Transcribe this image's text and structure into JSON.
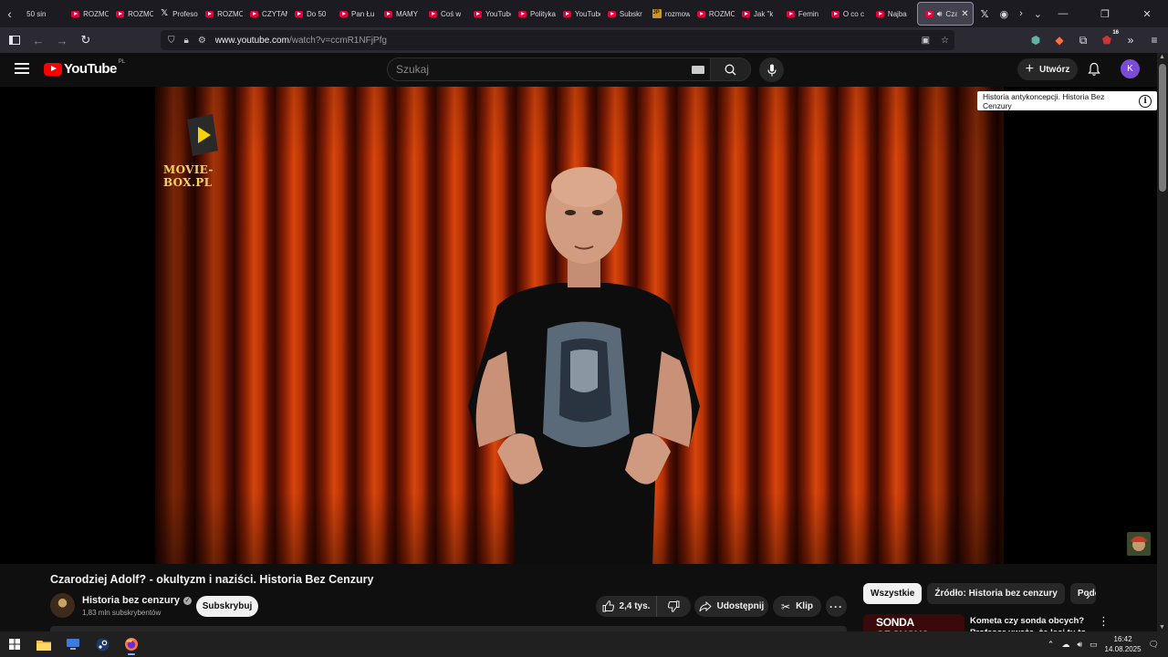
{
  "browser": {
    "tabs": [
      {
        "title": "50 sin",
        "icon": "none"
      },
      {
        "title": "ROZMOWA",
        "icon": "youtube"
      },
      {
        "title": "ROZMOWA",
        "icon": "youtube"
      },
      {
        "title": "Profesor",
        "icon": "x"
      },
      {
        "title": "ROZMOWA",
        "icon": "youtube"
      },
      {
        "title": "CZYTAMY",
        "icon": "youtube"
      },
      {
        "title": "Do 50",
        "icon": "youtube"
      },
      {
        "title": "Pan Łu",
        "icon": "youtube"
      },
      {
        "title": "MAMY",
        "icon": "youtube"
      },
      {
        "title": "Coś w",
        "icon": "youtube"
      },
      {
        "title": "YouTube",
        "icon": "youtube"
      },
      {
        "title": "Polityka",
        "icon": "youtube"
      },
      {
        "title": "YouTube",
        "icon": "youtube"
      },
      {
        "title": "Subskr",
        "icon": "youtube"
      },
      {
        "title": "rozmowa",
        "icon": "jp"
      },
      {
        "title": "ROZMOWA",
        "icon": "youtube"
      },
      {
        "title": "Jak \"k",
        "icon": "youtube"
      },
      {
        "title": "Femin",
        "icon": "youtube"
      },
      {
        "title": "O co c",
        "icon": "youtube"
      },
      {
        "title": "Najba",
        "icon": "youtube"
      }
    ],
    "active_tab": {
      "title": "Czarodziej"
    },
    "url_host": "www.youtube.com",
    "url_path": "/watch?v=ccmR1NFjPfg",
    "extension_badge": "16"
  },
  "youtube": {
    "logo_text": "YouTube",
    "country_code": "PL",
    "search_placeholder": "Szukaj",
    "create_label": "Utwórz",
    "avatar_letter": "K"
  },
  "player": {
    "overlay_logo_text": "MOVIE-BOX.PL",
    "info_card_text": "Historia antykoncepcji. Historia Bez Cenzury"
  },
  "video": {
    "title": "Czarodziej Adolf? - okultyzm i naziści. Historia Bez Cenzury",
    "channel_name": "Historia bez cenzury",
    "subscribers": "1,83 mln subskrybentów",
    "subscribe_label": "Subskrybuj",
    "likes": "2,4 tys.",
    "share_label": "Udostępnij",
    "clip_label": "Klip"
  },
  "sidebar": {
    "chips": [
      "Wszystkie",
      "Źródło: Historia bez cenzury",
      "Podobne"
    ],
    "recommendation": {
      "thumb_text": "SONDA OBCYCH?",
      "title": "Kometa czy sonda obcych? Profesor uważa, że leci tu to"
    }
  },
  "taskbar": {
    "time": "16:42",
    "date": "14.08.2025"
  }
}
